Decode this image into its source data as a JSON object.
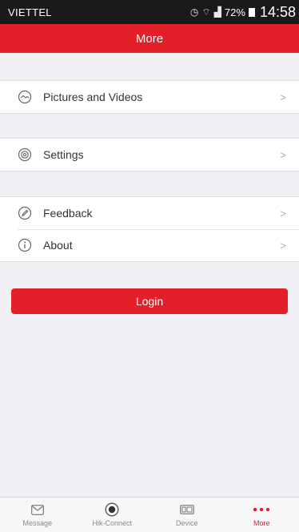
{
  "status_bar": {
    "carrier": "VIETTEL",
    "battery": "72%",
    "time": "14:58"
  },
  "header": {
    "title": "More"
  },
  "menu": {
    "pictures": {
      "label": "Pictures and Videos",
      "icon": "pictures-icon"
    },
    "settings": {
      "label": "Settings",
      "icon": "settings-gear-icon"
    },
    "feedback": {
      "label": "Feedback",
      "icon": "feedback-pen-icon"
    },
    "about": {
      "label": "About",
      "icon": "about-info-icon"
    }
  },
  "login": {
    "label": "Login"
  },
  "tabs": [
    {
      "label": "Message",
      "icon": "message-envelope-icon"
    },
    {
      "label": "Hik-Connect",
      "icon": "hik-connect-icon"
    },
    {
      "label": "Device",
      "icon": "device-icon"
    },
    {
      "label": "More",
      "icon": "more-dots-icon",
      "active": true
    }
  ],
  "colors": {
    "accent": "#e32029",
    "background": "#efeff4",
    "status_bar": "#1a1a1a"
  }
}
